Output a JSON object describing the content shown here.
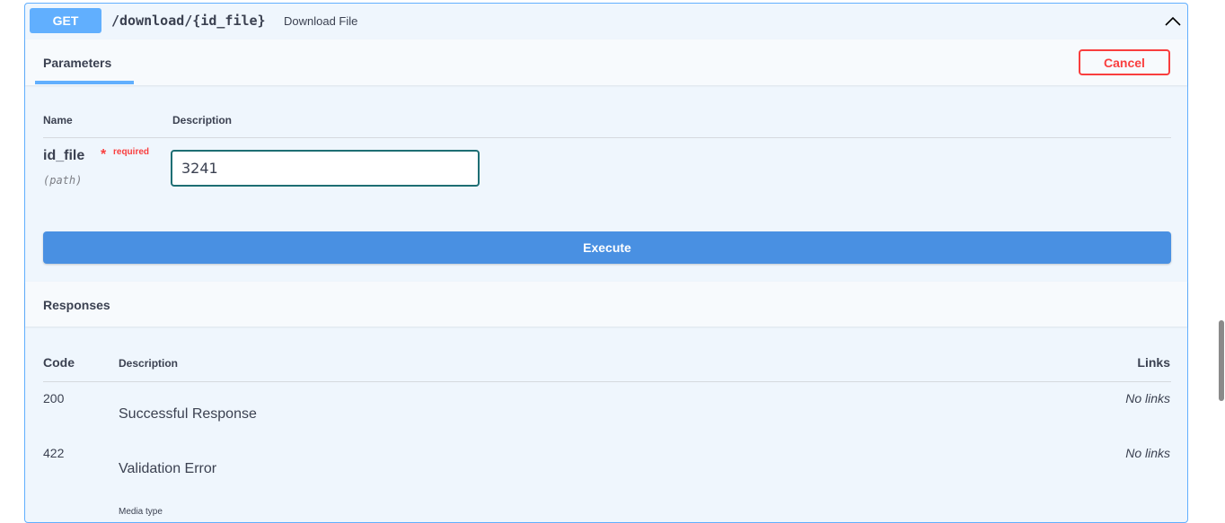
{
  "summary": {
    "method": "GET",
    "path": "/download/{id_file}",
    "description": "Download File",
    "icon": "chevron-up-icon"
  },
  "parameters": {
    "tab_label": "Parameters",
    "cancel_label": "Cancel",
    "col_name": "Name",
    "col_description": "Description",
    "items": [
      {
        "name": "id_file",
        "required_star": "*",
        "required_text": "required",
        "location": "(path)",
        "value": "3241"
      }
    ]
  },
  "execute_label": "Execute",
  "responses": {
    "title": "Responses",
    "col_code": "Code",
    "col_description": "Description",
    "col_links": "Links",
    "rows": [
      {
        "code": "200",
        "description": "Successful Response",
        "links": "No links"
      },
      {
        "code": "422",
        "description": "Validation Error",
        "links": "No links"
      }
    ],
    "media_type_label": "Media type"
  },
  "colors": {
    "get_accent": "#61affe",
    "cancel": "#f93e3e",
    "execute": "#4990e2",
    "input_border": "#1e6e73"
  }
}
